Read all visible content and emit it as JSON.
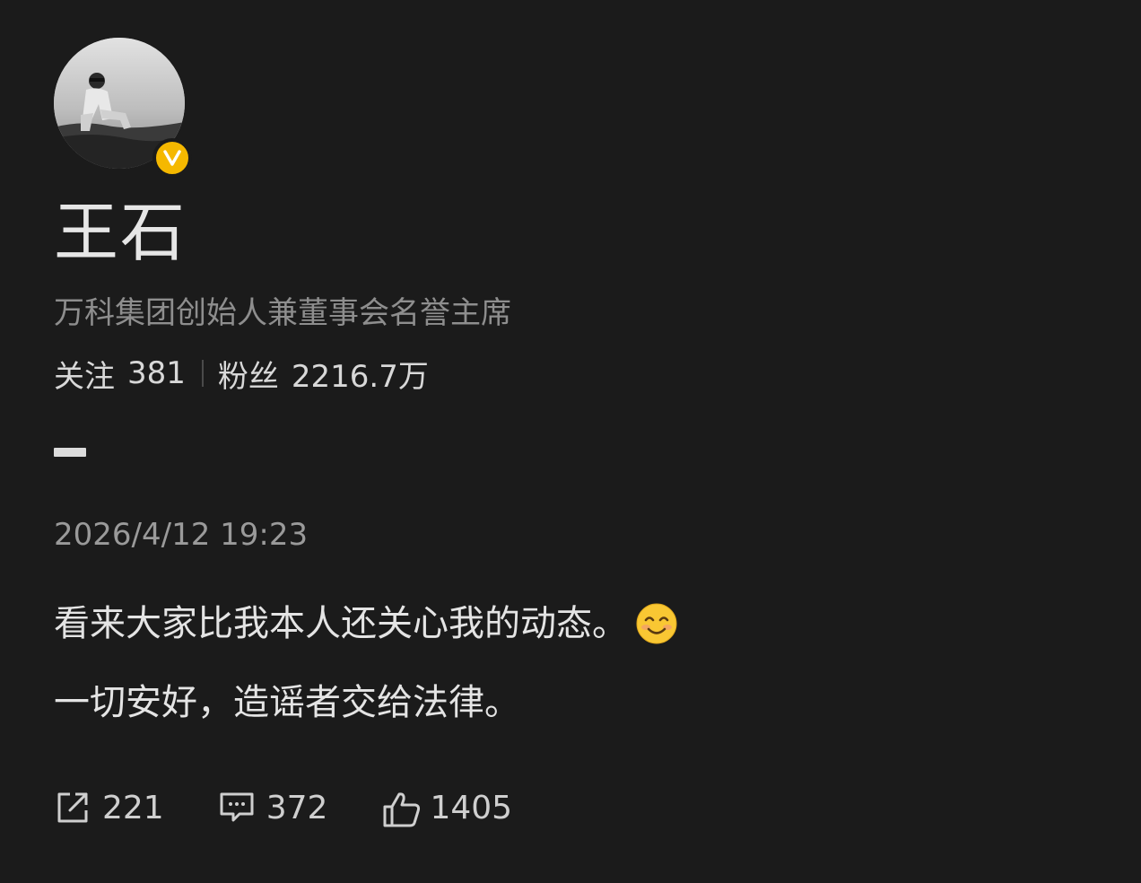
{
  "profile": {
    "name": "王石",
    "bio": "万科集团创始人兼董事会名誉主席",
    "verified": true,
    "badge_color": "#f5b800",
    "avatar_icon": "user-avatar-photo"
  },
  "stats": {
    "following_label": "关注",
    "following_count": "381",
    "followers_label": "粉丝",
    "followers_count": "2216.7万"
  },
  "post": {
    "timestamp": "2026/4/12 19:23",
    "line1": "看来大家比我本人还关心我的动态。",
    "line1_emoji": "smiling-face-emoji",
    "line2": "一切安好，造谣者交给法律。"
  },
  "actions": {
    "share_icon": "share-icon",
    "share_count": "221",
    "comment_icon": "comment-icon",
    "comment_count": "372",
    "like_icon": "thumbs-up-icon",
    "like_count": "1405"
  },
  "colors": {
    "background": "#1b1b1b",
    "text_primary": "#e4e4e4",
    "text_secondary": "#8e8e8e",
    "badge": "#f5b800"
  }
}
